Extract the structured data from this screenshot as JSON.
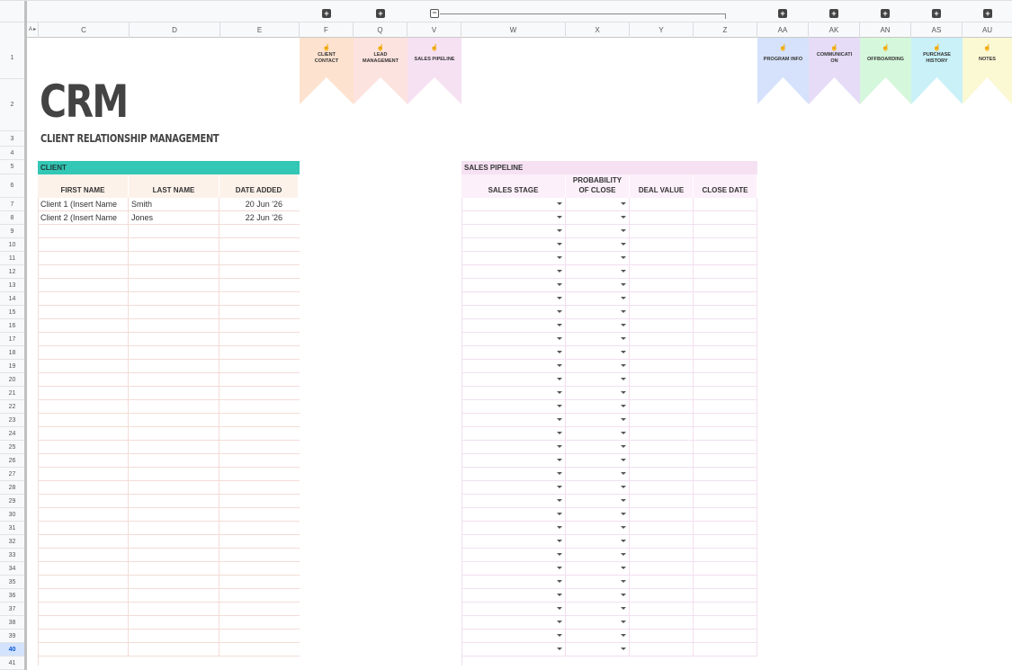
{
  "columns": {
    "corner": "A",
    "c": "C",
    "d": "D",
    "e": "E",
    "f": "F",
    "q": "Q",
    "v": "V",
    "w": "W",
    "x": "X",
    "y": "Y",
    "z": "Z",
    "aa": "AA",
    "ak": "AK",
    "an": "AN",
    "as": "AS",
    "au": "AU"
  },
  "rows": [
    "1",
    "2",
    "3",
    "4",
    "5",
    "6",
    "7",
    "8",
    "9",
    "10",
    "11",
    "12",
    "13",
    "14",
    "15",
    "16",
    "17",
    "18",
    "19",
    "20",
    "21",
    "22",
    "23",
    "24",
    "25",
    "26",
    "27",
    "28",
    "29",
    "30",
    "31",
    "32",
    "33",
    "34",
    "35",
    "36",
    "37",
    "38",
    "39",
    "40",
    "41"
  ],
  "active_row": "40",
  "banners": [
    {
      "label": "CLIENT\nCONTACT",
      "color": "#fde2cf"
    },
    {
      "label": "LEAD\nMANAGEMENT",
      "color": "#fde3df"
    },
    {
      "label": "SALES PIPELINE",
      "color": "#f6e1f3"
    },
    {
      "label": "PROGRAM INFO",
      "color": "#d6e2fb"
    },
    {
      "label": "COMMUNICATI\nON",
      "color": "#e6dcf7"
    },
    {
      "label": "OFFBOARDING",
      "color": "#d5f7db"
    },
    {
      "label": "PURCHASE\nHISTORY",
      "color": "#c9f1f7"
    },
    {
      "label": "NOTES",
      "color": "#fbf8d4"
    }
  ],
  "title": "CRM",
  "subtitle": "CLIENT RELATIONSHIP MANAGEMENT",
  "client": {
    "header": "CLIENT",
    "header_color": "#33c7b5",
    "columns": [
      "FIRST NAME",
      "LAST NAME",
      "DATE ADDED"
    ],
    "rows": [
      {
        "first": "Client 1 (Insert Name",
        "last": "Smith",
        "date": "20 Jun '26"
      },
      {
        "first": "Client 2 (Insert Name",
        "last": "Jones",
        "date": "22 Jun '26"
      }
    ]
  },
  "pipeline": {
    "header": "SALES PIPELINE",
    "header_color": "#f6e1f3",
    "columns": [
      "SALES STAGE",
      "PROBABILITY\nOF CLOSE",
      "DEAL VALUE",
      "CLOSE DATE"
    ]
  }
}
